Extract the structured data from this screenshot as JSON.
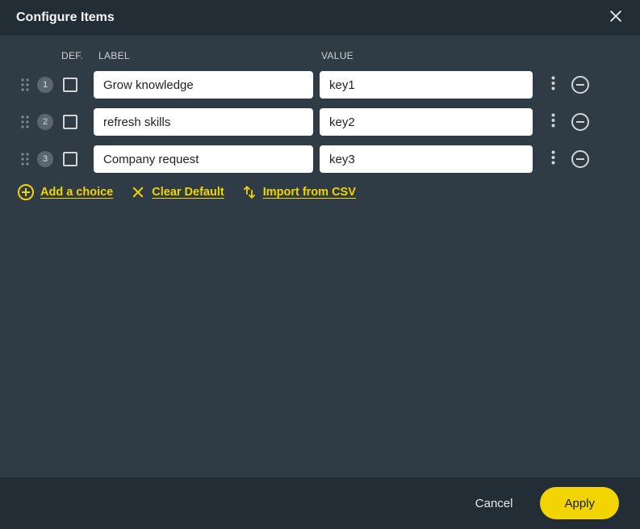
{
  "dialog": {
    "title": "Configure Items"
  },
  "headers": {
    "def": "DEF.",
    "label": "LABEL",
    "value": "VALUE"
  },
  "rows": [
    {
      "num": "1",
      "label": "Grow knowledge",
      "value": "key1"
    },
    {
      "num": "2",
      "label": "refresh skills",
      "value": "key2"
    },
    {
      "num": "3",
      "label": "Company request",
      "value": "key3"
    }
  ],
  "actions": {
    "add": "Add a choice",
    "clear": "Clear Default",
    "import": "Import from CSV"
  },
  "footer": {
    "cancel": "Cancel",
    "apply": "Apply"
  }
}
